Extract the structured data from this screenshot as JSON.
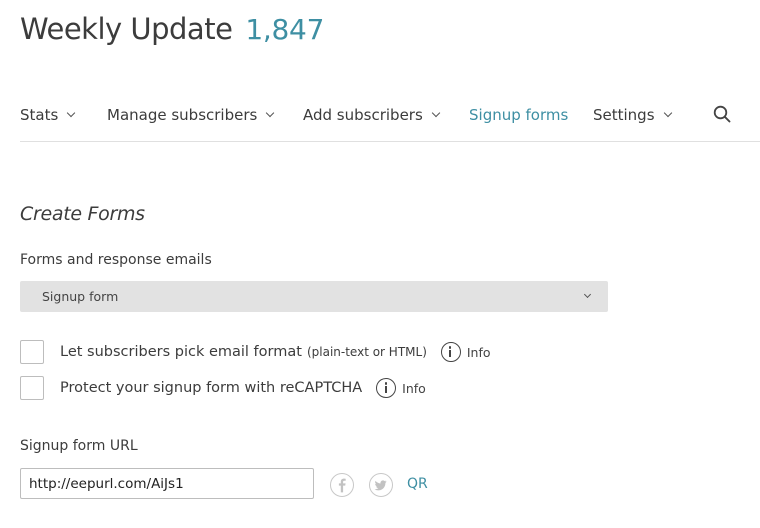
{
  "header": {
    "title": "Weekly Update",
    "subscriber_count": "1,847"
  },
  "nav": {
    "items": [
      {
        "label": "Stats"
      },
      {
        "label": "Manage subscribers"
      },
      {
        "label": "Add subscribers"
      },
      {
        "label": "Signup forms"
      },
      {
        "label": "Settings"
      }
    ],
    "active_item": "Signup forms",
    "search_icon": "search-icon"
  },
  "main": {
    "section_title": "Create Forms",
    "forms_label": "Forms and response emails",
    "forms_select": {
      "selected": "Signup form"
    },
    "options": [
      {
        "label": "Let subscribers pick email format",
        "hint": "(plain-text or HTML)",
        "info_label": "Info",
        "checked": false
      },
      {
        "label": "Protect your signup form with reCAPTCHA",
        "info_label": "Info",
        "checked": false
      }
    ],
    "url_label": "Signup form URL",
    "url_value": "http://eepurl.com/AiJs1",
    "share_icons": [
      "facebook-icon",
      "twitter-icon"
    ],
    "qr_label": "QR"
  },
  "colors": {
    "accent": "#3e8fa3",
    "text": "#3c3c3c",
    "select_bg": "#e2e2e2"
  }
}
